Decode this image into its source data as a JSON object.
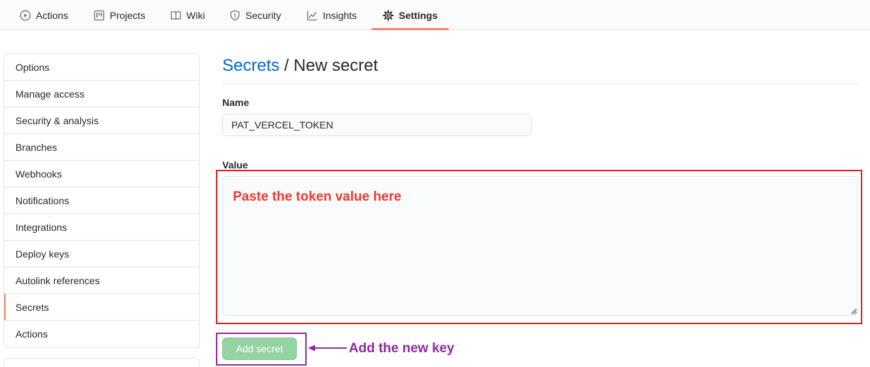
{
  "nav": {
    "tabs": [
      {
        "label": "Actions",
        "icon": "play-icon"
      },
      {
        "label": "Projects",
        "icon": "project-board-icon"
      },
      {
        "label": "Wiki",
        "icon": "book-icon"
      },
      {
        "label": "Security",
        "icon": "shield-icon"
      },
      {
        "label": "Insights",
        "icon": "graph-icon"
      },
      {
        "label": "Settings",
        "icon": "gear-icon",
        "active": true
      }
    ],
    "accent_color": "#f9826c"
  },
  "sidebar": {
    "items": [
      {
        "label": "Options"
      },
      {
        "label": "Manage access"
      },
      {
        "label": "Security & analysis"
      },
      {
        "label": "Branches"
      },
      {
        "label": "Webhooks"
      },
      {
        "label": "Notifications"
      },
      {
        "label": "Integrations"
      },
      {
        "label": "Deploy keys"
      },
      {
        "label": "Autolink references"
      },
      {
        "label": "Secrets",
        "active": true
      },
      {
        "label": "Actions"
      }
    ]
  },
  "main": {
    "breadcrumb_link": "Secrets",
    "breadcrumb_sep": " / ",
    "title": "New secret",
    "name_label": "Name",
    "name_value": "PAT_VERCEL_TOKEN",
    "value_label": "Value",
    "value_text": "",
    "submit_label": "Add secret",
    "link_color": "#0366d6",
    "button_color": "#94d3a2"
  },
  "annotations": {
    "value_hint": "Paste the token value here",
    "value_hint_color": "#ef3b2c",
    "button_hint": "Add the new key",
    "button_hint_color": "#8e2a9e"
  }
}
